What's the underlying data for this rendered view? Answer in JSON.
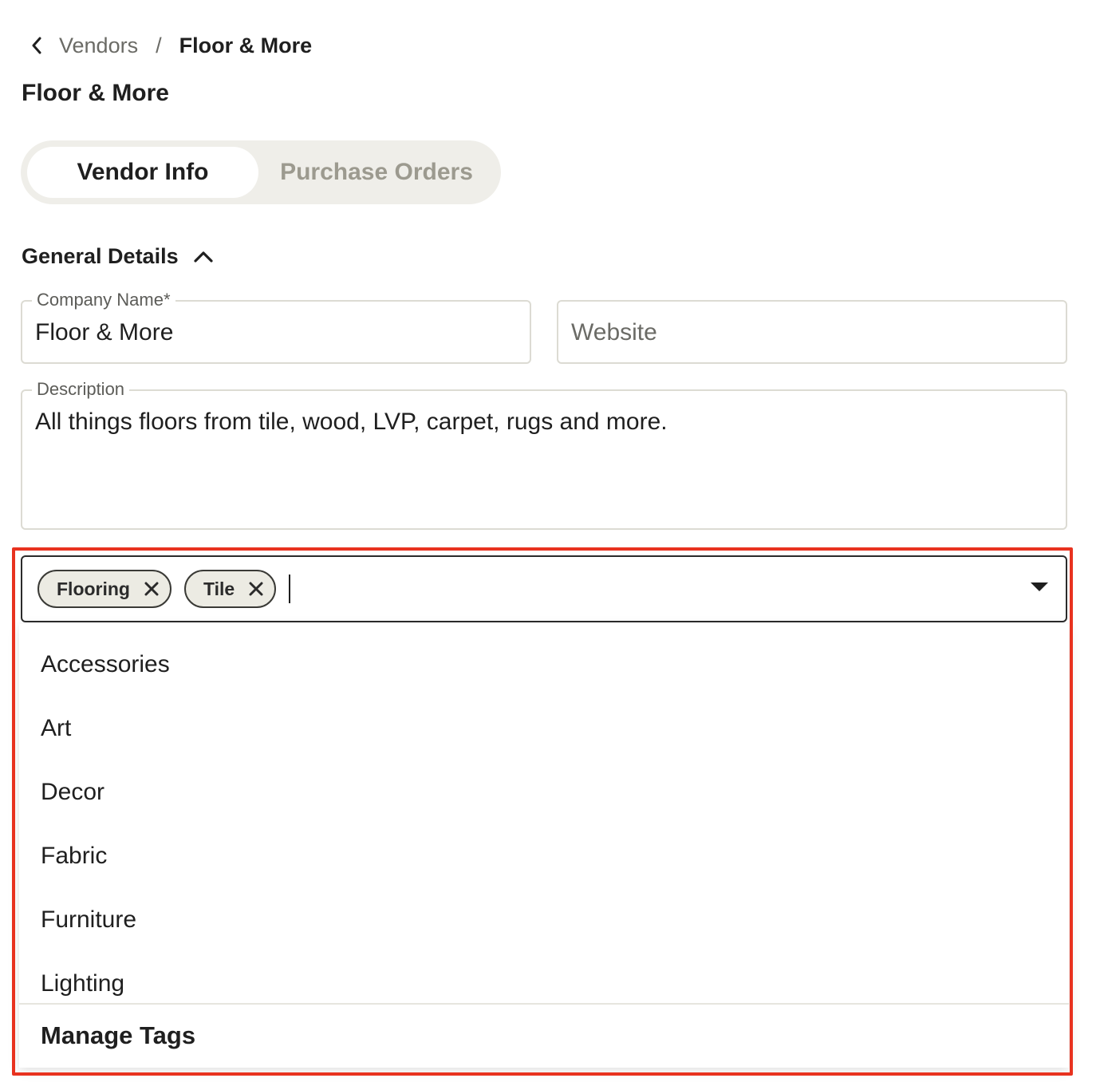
{
  "breadcrumb": {
    "parent": "Vendors",
    "separator": "/",
    "current": "Floor & More"
  },
  "page": {
    "title": "Floor & More"
  },
  "tabs": [
    {
      "label": "Vendor Info",
      "active": true
    },
    {
      "label": "Purchase Orders",
      "active": false
    }
  ],
  "section": {
    "title": "General Details",
    "expanded": true
  },
  "form": {
    "company_name": {
      "label": "Company Name*",
      "value": "Floor & More"
    },
    "website": {
      "placeholder": "Website"
    },
    "description": {
      "label": "Description",
      "value": "All things floors from tile, wood, LVP, carpet, rugs and more."
    }
  },
  "tags": {
    "selected": [
      "Flooring",
      "Tile"
    ],
    "options": [
      "Accessories",
      "Art",
      "Decor",
      "Fabric",
      "Furniture",
      "Lighting"
    ],
    "manage_label": "Manage Tags"
  },
  "colors": {
    "highlight": "#e8321f",
    "chip_bg": "#ecebe3",
    "tab_track": "#efeee9",
    "inactive_text": "#9c9a8f"
  }
}
